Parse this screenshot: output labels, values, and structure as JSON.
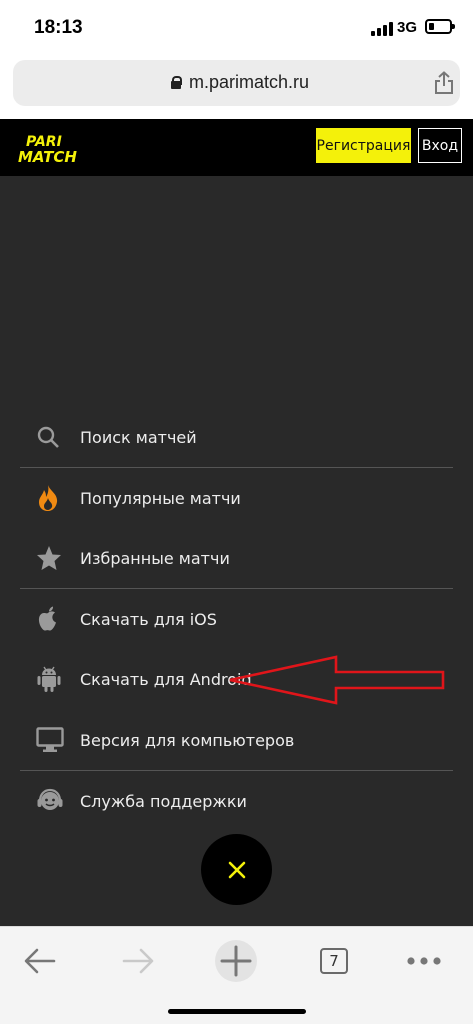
{
  "status_bar": {
    "time": "18:13",
    "network": "3G"
  },
  "browser": {
    "url": "m.parimatch.ru",
    "tabs_count": "7"
  },
  "header": {
    "logo_line1": "PARI",
    "logo_line2": "MATCH",
    "register_label": "Регистрация",
    "login_label": "Вход"
  },
  "menu": {
    "items": [
      {
        "label": "Поиск матчей",
        "icon": "search-icon"
      },
      {
        "label": "Популярные матчи",
        "icon": "fire-icon"
      },
      {
        "label": "Избранные матчи",
        "icon": "star-icon"
      },
      {
        "label": "Скачать для iOS",
        "icon": "apple-icon"
      },
      {
        "label": "Скачать для Android",
        "icon": "android-icon"
      },
      {
        "label": "Версия для компьютеров",
        "icon": "monitor-icon"
      },
      {
        "label": "Служба поддержки",
        "icon": "support-icon"
      }
    ]
  },
  "colors": {
    "brand_yellow": "#f4f10a",
    "menu_bg": "#292929",
    "fire_orange": "#f08a12",
    "annotation_red": "#e0151a"
  }
}
